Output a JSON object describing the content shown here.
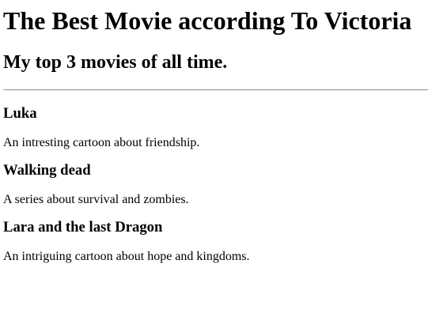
{
  "page": {
    "title": "The Best Movie according To Victoria",
    "subtitle": "My top 3 movies of all time."
  },
  "movies": [
    {
      "name": "Luka",
      "description": "An intresting cartoon about friendship."
    },
    {
      "name": "Walking dead",
      "description": "A series about survival and zombies."
    },
    {
      "name": "Lara and the last Dragon",
      "description": "An intriguing cartoon about hope and kingdoms."
    }
  ]
}
